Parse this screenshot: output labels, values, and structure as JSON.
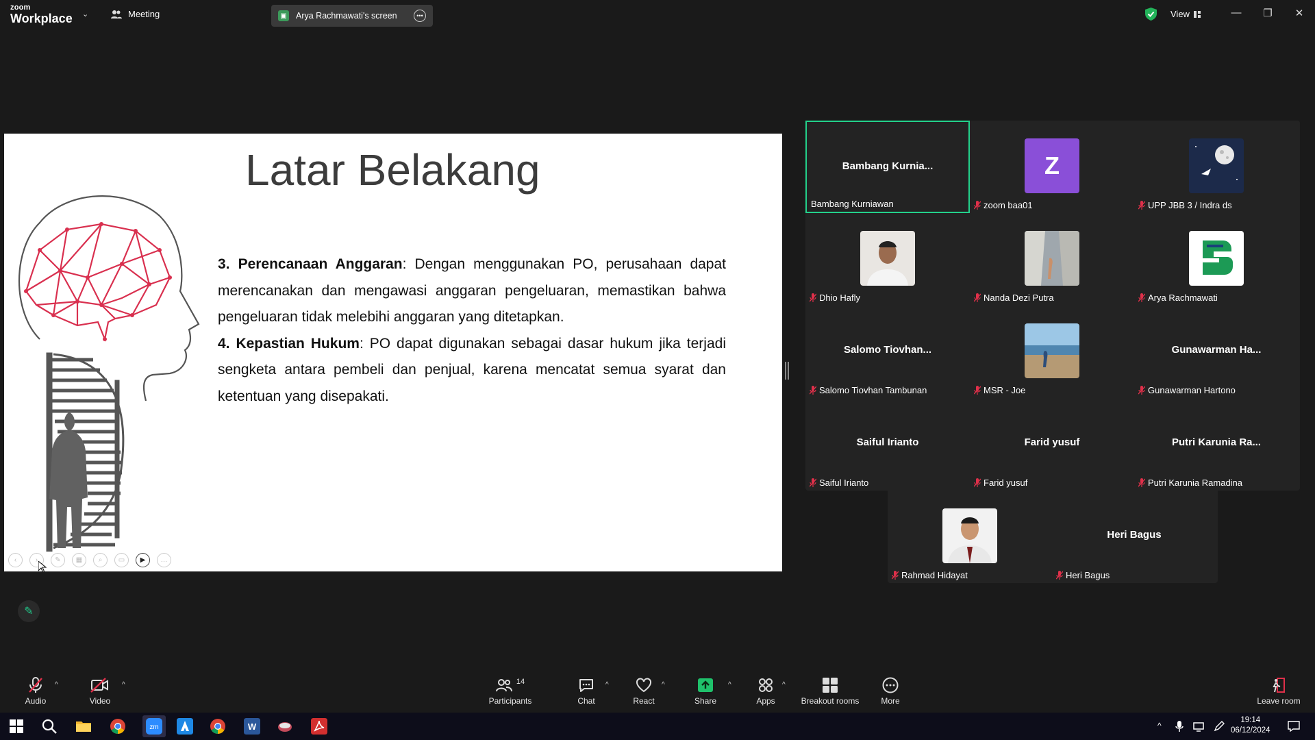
{
  "app": {
    "brand_small": "zoom",
    "brand_big": "Workplace",
    "meeting_label": "Meeting",
    "screen_tab": "Arya Rachmawati's screen",
    "view_label": "View"
  },
  "slide": {
    "title": "Latar Belakang",
    "item3_bold": "3. Perencanaan Anggaran",
    "item3_text": ": Dengan menggunakan PO, perusahaan dapat merencanakan dan mengawasi anggaran pengeluaran, memastikan bahwa pengeluaran tidak melebihi anggaran yang ditetapkan.",
    "item4_bold": "4. Kepastian Hukum",
    "item4_text": ": PO dapat digunakan sebagai dasar hukum jika terjadi sengketa antara pembeli dan penjual, karena mencatat semua syarat dan ketentuan yang disepakati."
  },
  "gallery": {
    "tiles": [
      {
        "big": "Bambang  Kurnia...",
        "label": "Bambang Kurniawan",
        "avatar": "",
        "active": true,
        "muted": false
      },
      {
        "big": "",
        "label": "zoom baa01",
        "avatar": "Z",
        "muted": true
      },
      {
        "big": "",
        "label": "UPP JBB 3 / Indra ds",
        "avatar": "moon-rocket",
        "muted": true
      },
      {
        "big": "",
        "label": "Dhio Hafly",
        "avatar": "photo-man",
        "muted": true
      },
      {
        "big": "",
        "label": "Nanda Dezi Putra",
        "avatar": "photo-rocks",
        "muted": true
      },
      {
        "big": "",
        "label": "Arya Rachmawati",
        "avatar": "logo-green",
        "muted": true
      },
      {
        "big": "Salomo  Tiovhan...",
        "label": "Salomo Tiovhan Tambunan",
        "avatar": "",
        "muted": true
      },
      {
        "big": "",
        "label": "MSR - Joe",
        "avatar": "photo-beach",
        "muted": true
      },
      {
        "big": "Gunawarman  Ha...",
        "label": "Gunawarman Hartono",
        "avatar": "",
        "muted": true
      },
      {
        "big": "Saiful Irianto",
        "label": "Saiful Irianto",
        "avatar": "",
        "muted": true
      },
      {
        "big": "Farid yusuf",
        "label": "Farid yusuf",
        "avatar": "",
        "muted": true
      },
      {
        "big": "Putri  Karunia  Ra...",
        "label": "Putri Karunia Ramadina",
        "avatar": "",
        "muted": true
      },
      {
        "big": "",
        "label": "Rahmad Hidayat",
        "avatar": "photo-man2",
        "muted": true
      },
      {
        "big": "Heri Bagus",
        "label": "Heri Bagus",
        "avatar": "",
        "muted": true
      }
    ]
  },
  "toolbar": {
    "audio": "Audio",
    "video": "Video",
    "participants": "Participants",
    "participants_count": "14",
    "chat": "Chat",
    "react": "React",
    "share": "Share",
    "apps": "Apps",
    "breakout": "Breakout rooms",
    "more": "More",
    "leave": "Leave room"
  },
  "taskbar": {
    "time": "19:14",
    "date": "06/12/2024"
  },
  "colors": {
    "accent_green": "#23d18b",
    "muted_red": "#e0304a",
    "share_green": "#1fc16b"
  }
}
